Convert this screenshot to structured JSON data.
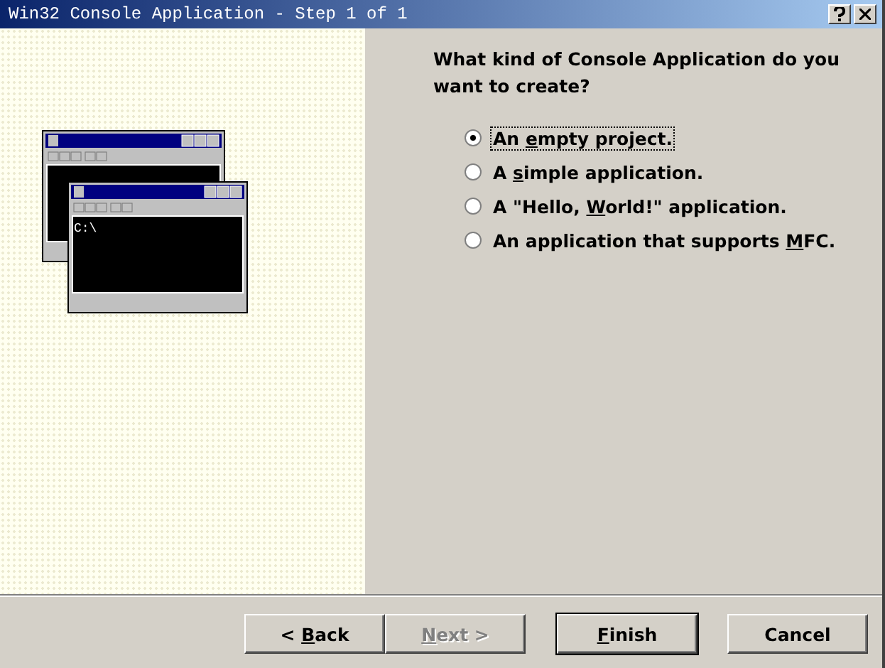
{
  "window": {
    "title": "Win32 Console Application - Step 1 of 1"
  },
  "illustration": {
    "console_prompt": "C:\\"
  },
  "question": "What kind of Console Application do you want to create?",
  "options": [
    {
      "before": "An ",
      "key": "e",
      "after": "mpty project.",
      "selected": true
    },
    {
      "before": "A ",
      "key": "s",
      "after": "imple application.",
      "selected": false
    },
    {
      "before": "A \"Hello, ",
      "key": "W",
      "after": "orld!\" application.",
      "selected": false
    },
    {
      "before": "An application that supports ",
      "key": "M",
      "after": "FC.",
      "selected": false
    }
  ],
  "buttons": [
    {
      "before": "< ",
      "key": "B",
      "after": "ack",
      "disabled": false,
      "default": false
    },
    {
      "key": "N",
      "after": "ext >",
      "disabled": true,
      "default": false
    },
    {
      "key": "F",
      "after": "inish",
      "disabled": false,
      "default": true
    },
    {
      "before": "Cancel",
      "disabled": false,
      "default": false
    }
  ]
}
